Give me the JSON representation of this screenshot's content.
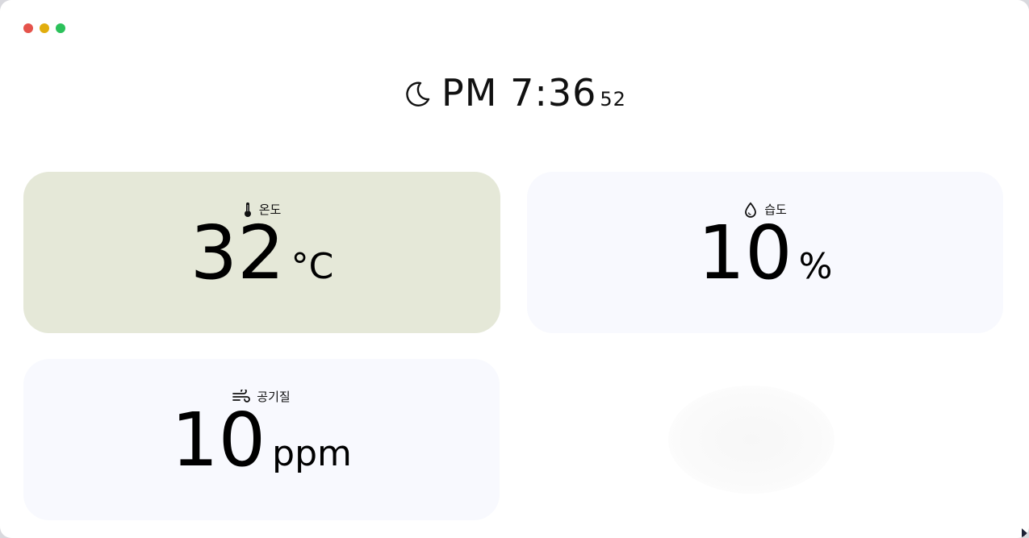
{
  "window": {
    "controls": [
      "close",
      "minimize",
      "maximize"
    ]
  },
  "clock": {
    "icon": "moon-icon",
    "period_time": "PM 7:36",
    "seconds": "52"
  },
  "cards": {
    "temperature": {
      "icon": "thermometer-icon",
      "label": "온도",
      "value": "32",
      "unit": "°C",
      "background": "#e5e8d8"
    },
    "humidity": {
      "icon": "water-drop-icon",
      "label": "습도",
      "value": "10",
      "unit": "%",
      "background": "#f8f9fe"
    },
    "air_quality": {
      "icon": "wind-icon",
      "label": "공기질",
      "value": "10",
      "unit": "ppm",
      "background": "#f8f9fe"
    }
  },
  "colors": {
    "close": "#e5534b",
    "minimize": "#e1ad0d",
    "maximize": "#2bc15a"
  }
}
